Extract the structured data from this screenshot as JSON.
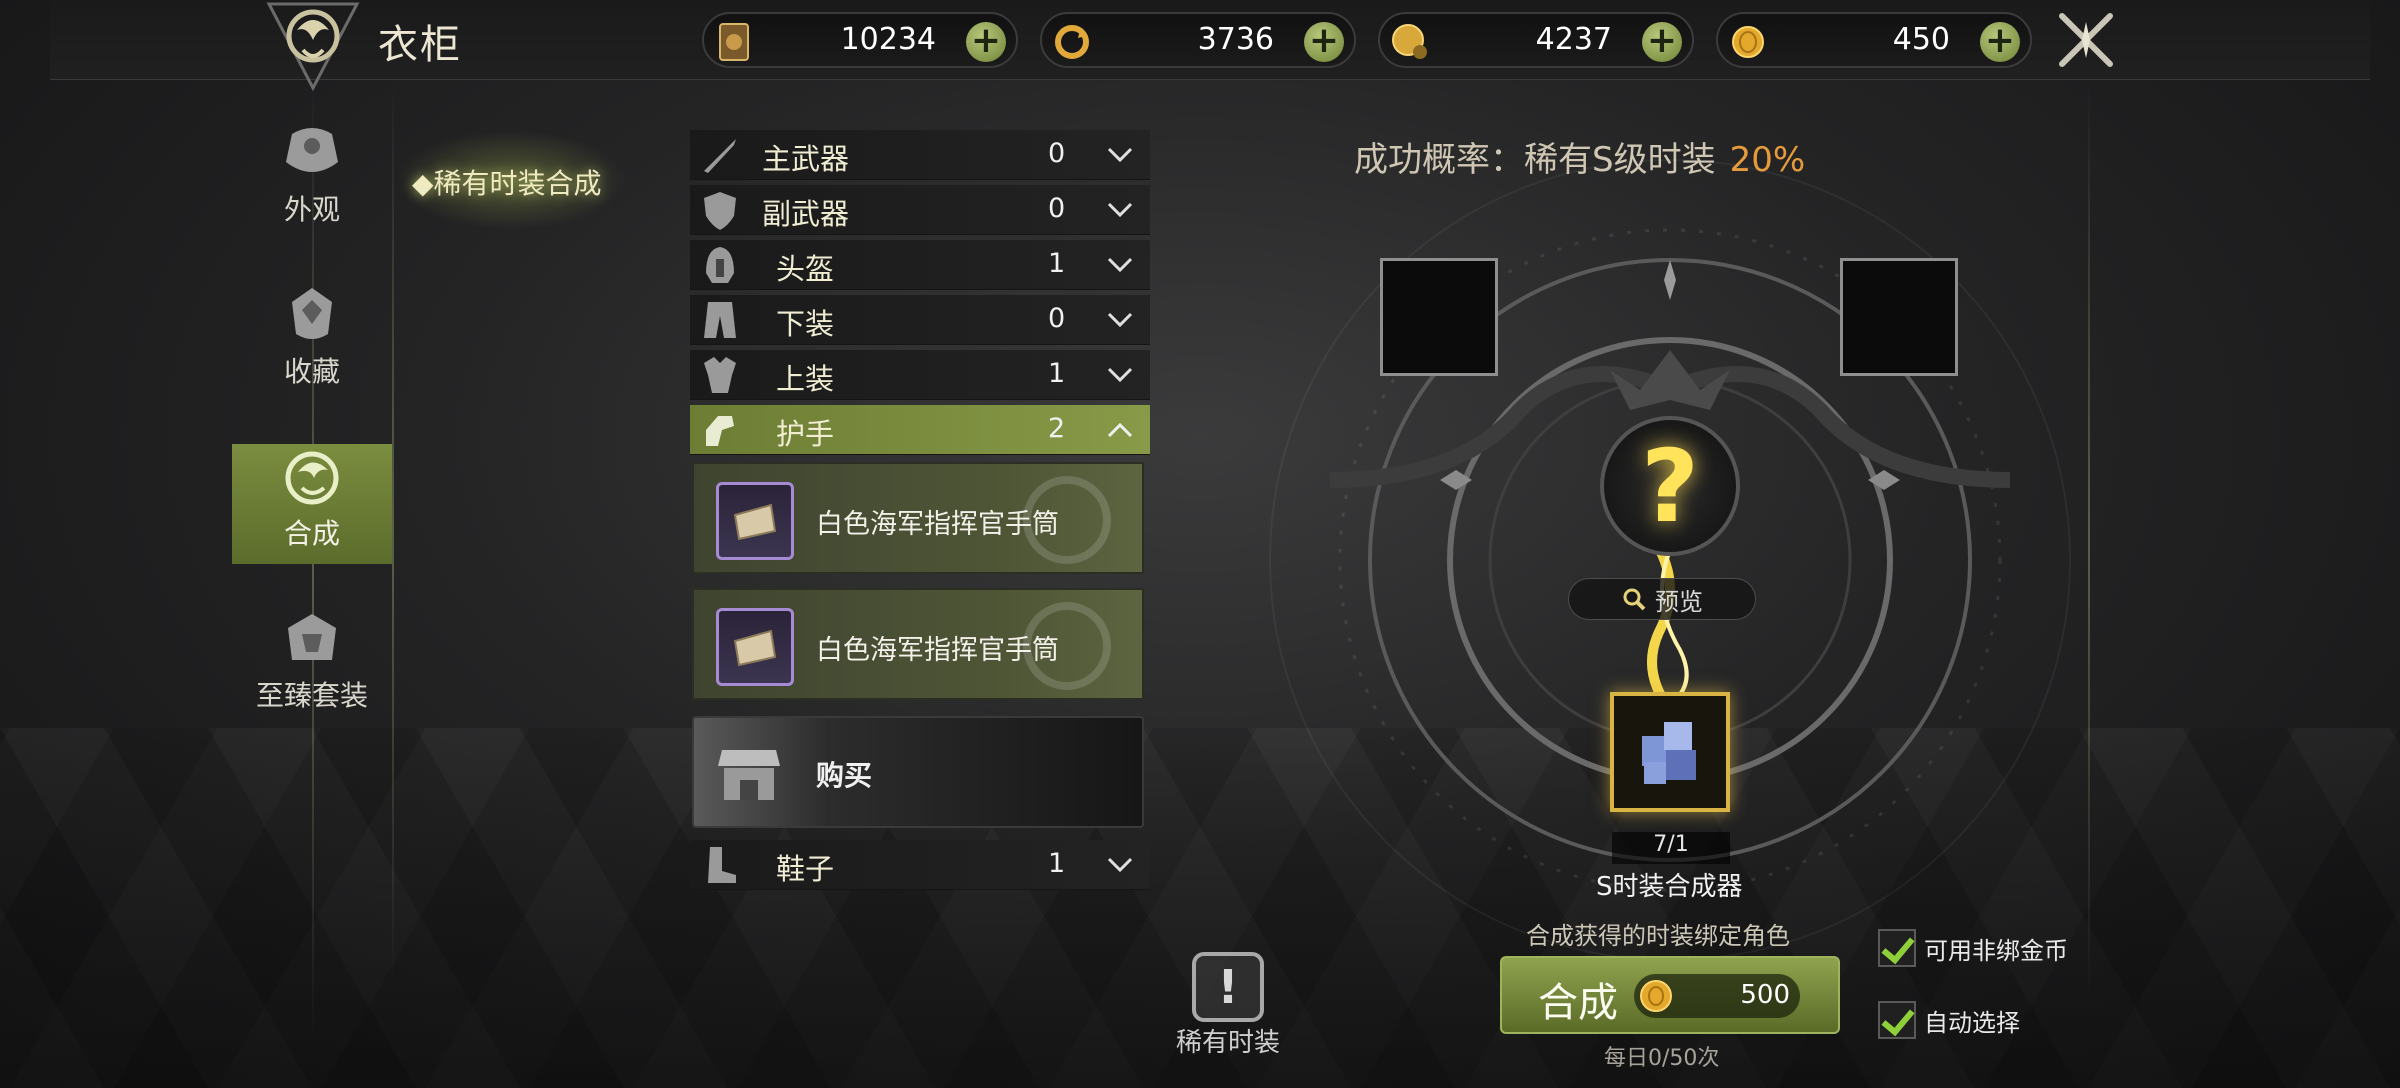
{
  "window": {
    "title": "衣柜"
  },
  "currencies": [
    {
      "name": "card-currency",
      "value": "10234"
    },
    {
      "name": "cycle-currency",
      "value": "3736"
    },
    {
      "name": "bound-gold",
      "value": "4237"
    },
    {
      "name": "gold",
      "value": "450"
    }
  ],
  "nav": {
    "items": [
      {
        "id": "appearance",
        "label": "外观",
        "active": false
      },
      {
        "id": "collection",
        "label": "收藏",
        "active": false
      },
      {
        "id": "synthesis",
        "label": "合成",
        "active": true
      },
      {
        "id": "ultimate-set",
        "label": "至臻套装",
        "active": false
      }
    ],
    "sub_tab": "◆稀有时装合成"
  },
  "categories": [
    {
      "label": "主武器",
      "count": "0",
      "open": false
    },
    {
      "label": "副武器",
      "count": "0",
      "open": false
    },
    {
      "label": "头盔",
      "count": "1",
      "open": false
    },
    {
      "label": "下装",
      "count": "0",
      "open": false
    },
    {
      "label": "上装",
      "count": "1",
      "open": false
    },
    {
      "label": "护手",
      "count": "2",
      "open": true
    },
    {
      "label": "鞋子",
      "count": "1",
      "open": false
    }
  ],
  "items": [
    {
      "label": "白色海军指挥官手筒"
    },
    {
      "label": "白色海军指挥官手筒"
    }
  ],
  "buy": {
    "label": "购买"
  },
  "rare_costume": {
    "label": "稀有时装"
  },
  "synthesis": {
    "probability_label": "成功概率：稀有S级时装",
    "probability_value": "20%",
    "preview_label": "预览",
    "material_count": "7/1",
    "material_name": "S时装合成器",
    "bind_note": "合成获得的时装绑定角色",
    "button_label": "合成",
    "cost": "500",
    "daily_limit": "每日0/50次"
  },
  "options": [
    {
      "label": "可用非绑金币",
      "checked": true
    },
    {
      "label": "自动选择",
      "checked": true
    }
  ],
  "colors": {
    "accent_green": "#7b8d3f",
    "probability_orange": "#e59a3c",
    "gold_border": "#d7b443",
    "rare_purple": "#a48bd4"
  }
}
